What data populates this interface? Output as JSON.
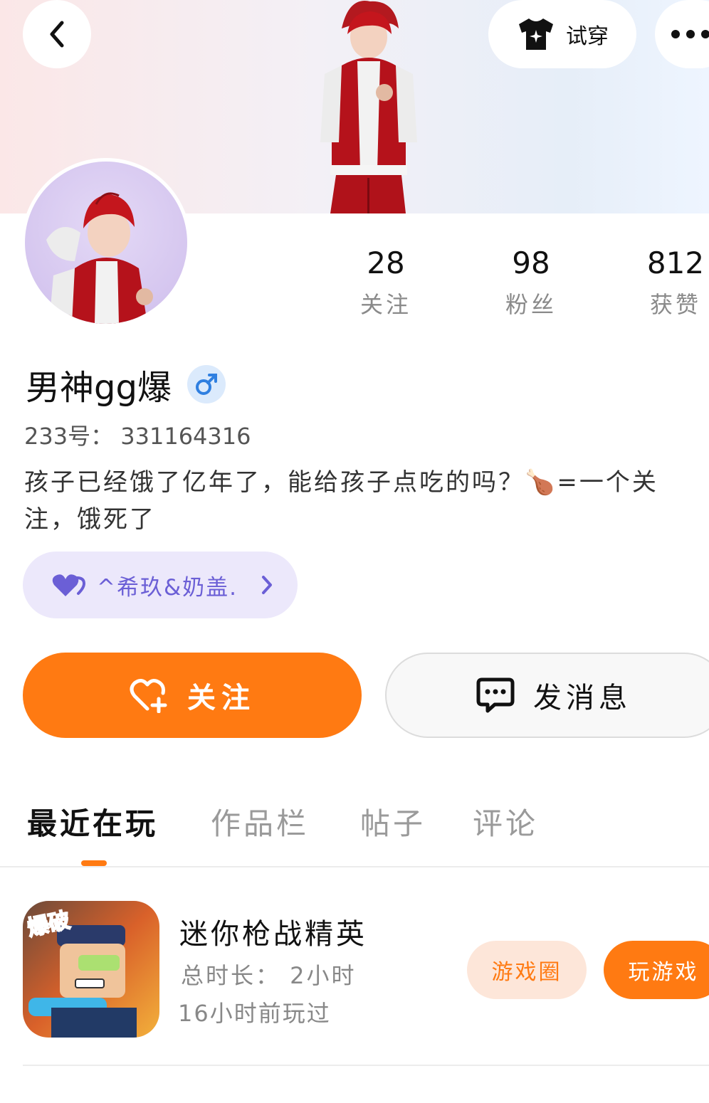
{
  "header": {
    "try_on_label": "试穿"
  },
  "profile": {
    "name": "男神gg爆",
    "uid_line": "233号： 331164316",
    "bio": "孩子已经饿了亿年了，能给孩子点吃的吗？🍗=一个关注，饿死了",
    "stats": [
      {
        "num": "28",
        "label": "关注"
      },
      {
        "num": "98",
        "label": "粉丝"
      },
      {
        "num": "812",
        "label": "获赞"
      }
    ],
    "group_label": "^希玖&奶盖."
  },
  "actions": {
    "follow_label": "关注",
    "message_label": "发消息"
  },
  "tabs": [
    {
      "label": "最近在玩",
      "active": true
    },
    {
      "label": "作品栏",
      "active": false
    },
    {
      "label": "帖子",
      "active": false
    },
    {
      "label": "评论",
      "active": false
    }
  ],
  "recent_games": [
    {
      "title": "迷你枪战精英",
      "duration": "总时长： 2小时",
      "last_played": "16小时前玩过",
      "circle_btn": "游戏圈",
      "play_btn": "玩游戏",
      "icon_text": "爆破"
    }
  ],
  "colors": {
    "accent": "#ff7a12",
    "group_pill_bg": "#ece8fb",
    "group_text": "#6b5fd6"
  }
}
